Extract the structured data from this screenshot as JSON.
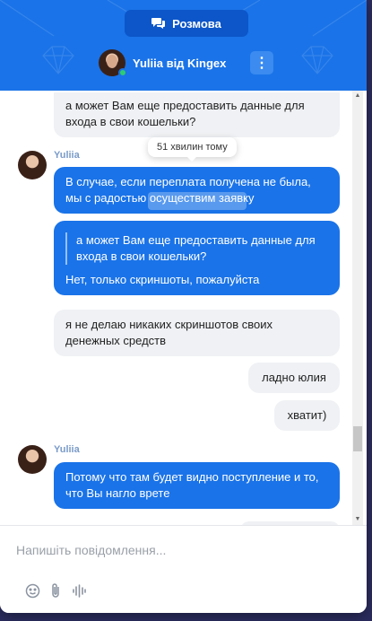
{
  "header": {
    "conversation_label": "Розмова",
    "agent_name": "Yuliia від Kingex",
    "menu_glyph": "⋮",
    "brand_color": "#1a73e8",
    "status": "online"
  },
  "tooltip": {
    "text": "51 хвилин тому"
  },
  "messages": [
    {
      "direction": "in",
      "text": "а может Вам еще предоставить данные для входа в свои кошельки?"
    },
    {
      "direction": "out",
      "sender": "Yuliia",
      "text": "В случае, если переплата получена не была, мы с радостью осуществим заявку"
    },
    {
      "direction": "out",
      "quote": "а может Вам еще предоставить данные для входа в свои кошельки?",
      "text": "Нет, только скриншоты, пожалуйста"
    },
    {
      "direction": "in",
      "text": "я не делаю никаких скриншотов своих денежных средств"
    },
    {
      "direction": "in",
      "text": "ладно юлия"
    },
    {
      "direction": "in",
      "text": "хватит)"
    },
    {
      "direction": "out",
      "sender": "Yuliia",
      "text": "Потому что там будет видно поступление и то, что Вы нагло врете"
    }
  ],
  "composer": {
    "placeholder": "Напишіть повідомлення...",
    "tools": [
      "emoji-icon",
      "attachment-icon",
      "voice-icon"
    ]
  }
}
